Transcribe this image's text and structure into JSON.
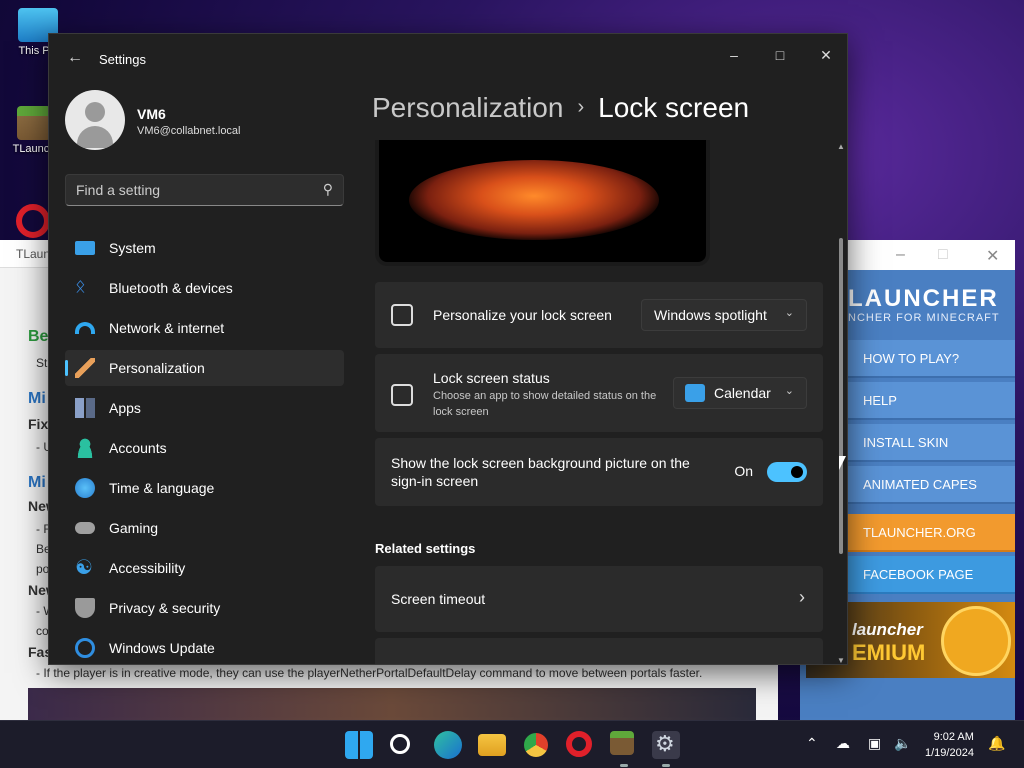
{
  "desktop": {
    "icons": [
      {
        "label": "This PC"
      },
      {
        "label": "TLaunch"
      }
    ]
  },
  "background_doc": {
    "window_title": "TLaunc",
    "lines": [
      {
        "text": "Be",
        "style": "hg"
      },
      {
        "text": "St"
      },
      {
        "text": "Mi",
        "style": "h"
      },
      {
        "text": "Fix"
      },
      {
        "text": "- U"
      },
      {
        "text": "Mi",
        "style": "h"
      },
      {
        "text": "New"
      },
      {
        "text": "- F"
      },
      {
        "text": "Be"
      },
      {
        "text": "po"
      },
      {
        "text": "New"
      },
      {
        "text": "- W"
      },
      {
        "text": "co"
      },
      {
        "text": "Fas"
      },
      {
        "text": "- If the player is in creative mode, they can use the playerNetherPortalDefaultDelay command to move between portals faster."
      }
    ]
  },
  "tlauncher": {
    "brand": "LAUNCHER",
    "tagline": "NCHER FOR MINECRAFT",
    "menu": [
      {
        "label": "HOW TO PLAY?"
      },
      {
        "label": "HELP"
      },
      {
        "label": "INSTALL SKIN"
      },
      {
        "label": "ANIMATED CAPES"
      },
      {
        "label": "TLAUNCHER.ORG"
      },
      {
        "label": "FACEBOOK PAGE"
      }
    ],
    "premium_line1": "launcher",
    "premium_line2": "EMIUM"
  },
  "settings": {
    "window_title": "Settings",
    "user": {
      "name": "VM6",
      "email": "VM6@collabnet.local"
    },
    "search_placeholder": "Find a setting",
    "nav": [
      {
        "label": "System",
        "icon": "system-icon",
        "color": "#3aa0e8"
      },
      {
        "label": "Bluetooth & devices",
        "icon": "bluetooth-icon",
        "color": "#3a8ee8"
      },
      {
        "label": "Network & internet",
        "icon": "wifi-icon",
        "color": "#2fa8f0"
      },
      {
        "label": "Personalization",
        "icon": "brush-icon",
        "color": "#e8a05a",
        "active": true
      },
      {
        "label": "Apps",
        "icon": "apps-icon",
        "color": "#8aa0c8"
      },
      {
        "label": "Accounts",
        "icon": "accounts-icon",
        "color": "#2ac0a0"
      },
      {
        "label": "Time & language",
        "icon": "globe-icon",
        "color": "#3aa0e8"
      },
      {
        "label": "Gaming",
        "icon": "gamepad-icon",
        "color": "#a0a0a0"
      },
      {
        "label": "Accessibility",
        "icon": "accessibility-icon",
        "color": "#3aa0e8"
      },
      {
        "label": "Privacy & security",
        "icon": "shield-icon",
        "color": "#9a9a9a"
      },
      {
        "label": "Windows Update",
        "icon": "update-icon",
        "color": "#2f8ee0"
      }
    ],
    "breadcrumb": {
      "parent": "Personalization",
      "separator": "›",
      "current": "Lock screen"
    },
    "personalize": {
      "title": "Personalize your lock screen",
      "value": "Windows spotlight"
    },
    "status": {
      "title": "Lock screen status",
      "desc": "Choose an app to show detailed status on the lock screen",
      "value": "Calendar"
    },
    "signin": {
      "title": "Show the lock screen background picture on the sign-in screen",
      "toggle_label": "On",
      "toggle_on": true
    },
    "related_heading": "Related settings",
    "screen_timeout": "Screen timeout"
  },
  "taskbar": {
    "time": "9:02 AM",
    "date": "1/19/2024"
  }
}
